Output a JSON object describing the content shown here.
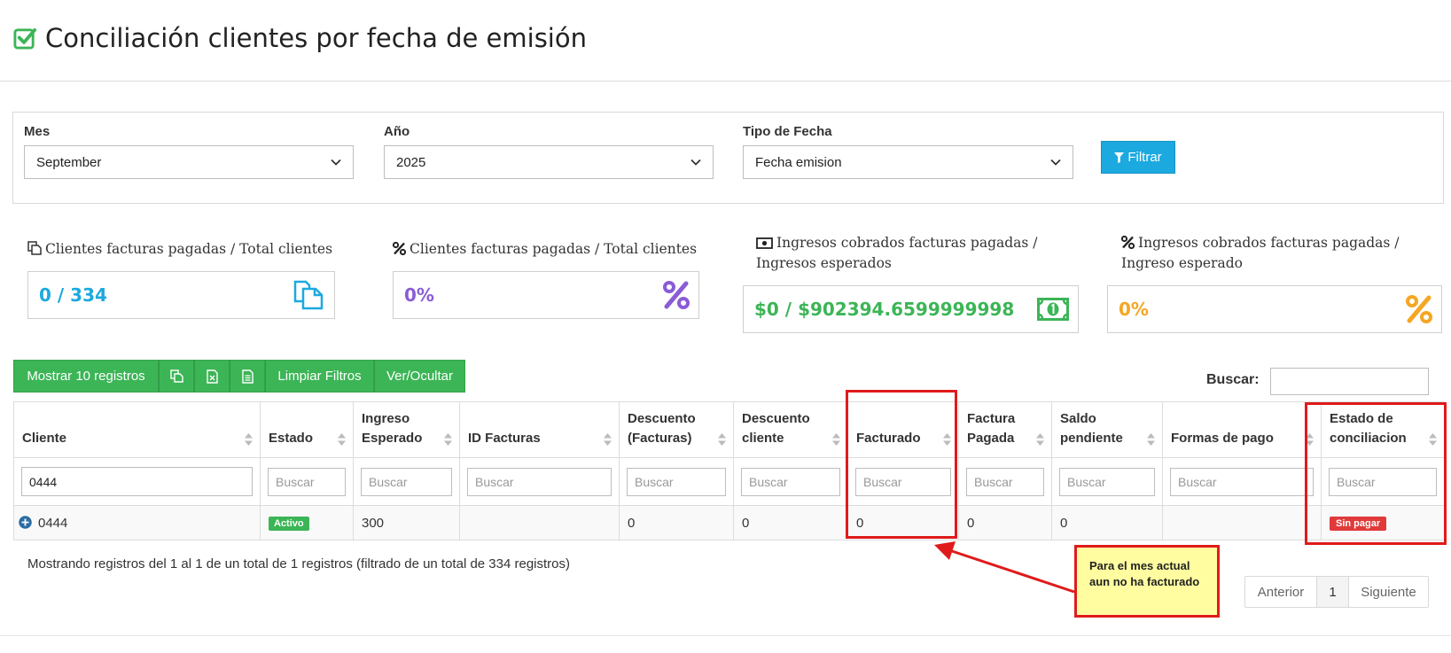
{
  "page": {
    "title": "Conciliación clientes por fecha de emisión"
  },
  "filters": {
    "month": {
      "label": "Mes",
      "value": "September"
    },
    "year": {
      "label": "Año",
      "value": "2025"
    },
    "date_type": {
      "label": "Tipo de Fecha",
      "value": "Fecha emision"
    },
    "filter_button": "Filtrar"
  },
  "stats": [
    {
      "label": "Clientes facturas pagadas / Total clientes",
      "value": "0 / 334",
      "color": "#1ca9e0",
      "icon": "copy-icon"
    },
    {
      "label": "Clientes facturas pagadas / Total clientes",
      "value": "0%",
      "color": "#8a5cd6",
      "icon": "percent-icon"
    },
    {
      "label": "Ingresos cobrados facturas pagadas / Ingresos esperados",
      "value": "$0 / $902394.6599999998",
      "color": "#3cb556",
      "icon": "money-icon"
    },
    {
      "label": "Ingresos cobrados facturas pagadas / Ingreso esperado",
      "value": "0%",
      "color": "#f5a623",
      "icon": "percent-icon"
    }
  ],
  "toolbar": {
    "show_records": "Mostrar 10 registros",
    "clear_filters": "Limpiar Filtros",
    "toggle_columns": "Ver/Ocultar",
    "search_label": "Buscar:"
  },
  "table": {
    "columns": [
      [
        "Cliente",
        ""
      ],
      [
        "Estado",
        ""
      ],
      [
        "Ingreso",
        "Esperado"
      ],
      [
        "ID Facturas",
        ""
      ],
      [
        "Descuento",
        "(Facturas)"
      ],
      [
        "Descuento",
        "cliente"
      ],
      [
        "Facturado",
        ""
      ],
      [
        "Factura",
        "Pagada"
      ],
      [
        "Saldo",
        "pendiente"
      ],
      [
        "Formas de pago",
        ""
      ],
      [
        "Estado de",
        "conciliacion"
      ]
    ],
    "filter_placeholder": "Buscar",
    "client_filter_value": "0444",
    "rows": [
      {
        "cliente": "0444",
        "estado": "Activo",
        "ingreso_esperado": "300",
        "id_facturas": "",
        "descuento_facturas": "0",
        "descuento_cliente": "0",
        "facturado": "0",
        "factura_pagada": "0",
        "saldo_pendiente": "0",
        "formas_pago": "",
        "estado_conciliacion": "Sin pagar"
      }
    ]
  },
  "info": "Mostrando registros del 1 al 1 de un total de 1 registros (filtrado de un total de 334 registros)",
  "pagination": {
    "prev": "Anterior",
    "current": "1",
    "next": "Siguiente"
  },
  "annotation": {
    "note": "Para el mes actual aun no ha facturado"
  }
}
